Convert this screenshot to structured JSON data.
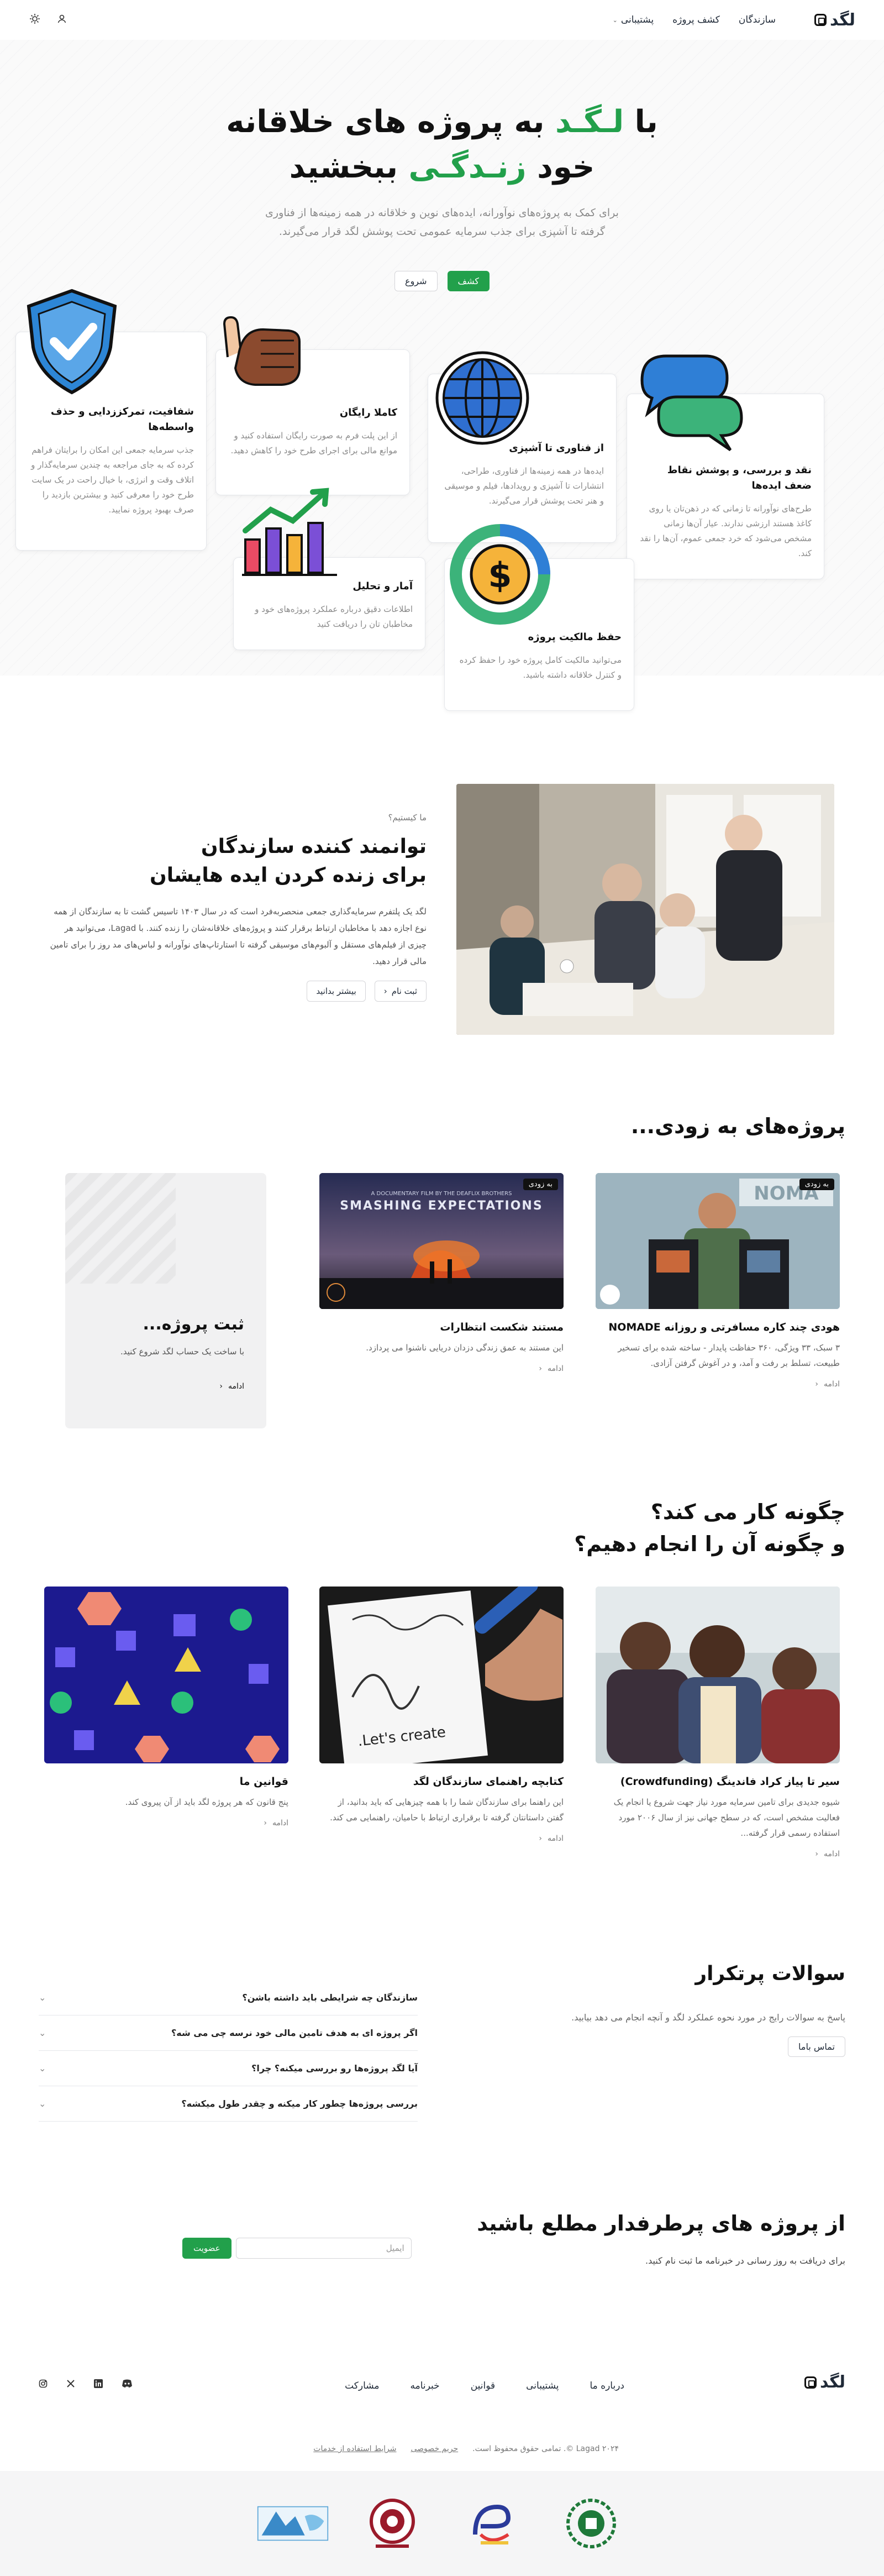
{
  "header": {
    "logo": "لگد",
    "nav": [
      "سازندگان",
      "کشف پروژه",
      "پشتیبانی"
    ],
    "nav_dropdown_icon": "chevron-down-icon"
  },
  "hero": {
    "title_line1_pre": "با",
    "title_line1_green": "لـگـد",
    "title_line1_post": "به پروژه های خلاقانه",
    "title_line2_pre": "خود",
    "title_line2_green": "زنـدگـی",
    "title_line2_post": "ببخشید",
    "subtitle": "برای کمک به پروژه‌های نوآورانه، ایده‌های نوین و خلاقانه در همه زمینه‌ها از فناوری گرفته تا آشپزی برای جذب سرمایه عمومی تحت پوشش لگد قرار می‌گیرند.",
    "btn_discover": "کشف",
    "btn_start": "شروع"
  },
  "features": [
    {
      "title": "شفافیت، تمرکززدایی و حذف واسطه‌ها",
      "desc": "جذب سرمایه جمعی این امکان را برایتان فراهم کرده که به جای مراجعه به چندین سرمایه‌گذار و اتلاف وقت و انرژی، با خیال راحت در یک سایت طرح خود را معرفی کنید و بیشترین بازدید را صرف بهبود پروژه نمایید."
    },
    {
      "title": "کاملا رایگان",
      "desc": "از این پلت فرم به صورت رایگان استفاده کنید و موانع مالی برای اجرای طرح خود را کاهش دهید."
    },
    {
      "title": "از فناوری تا آشپزی",
      "desc": "ایده‌ها در همه زمینه‌ها از فناوری، طراحی، انتشارات تا آشپزی و رویدادها، فیلم و موسیقی و هنر تحت پوشش قرار می‌گیرند."
    },
    {
      "title": "نقد و بررسی، و پوشش نقاط ضعف ایده‌ها",
      "desc": "طرح‌های نوآورانه تا زمانی که در ذهن‌تان یا روی کاغذ هستند ارزشی ندارند. عیار آن‌ها زمانی مشخص می‌شود که خرد جمعی عموم، آن‌ها را نقد کند."
    },
    {
      "title": "آمار و تحلیل",
      "desc": "اطلاعات دقیق درباره عملکرد پروژه‌های خود و مخاطبان تان را دریافت کنید"
    },
    {
      "title": "حفظ مالکیت پروژه",
      "desc": "می‌توانید مالکیت کامل پروژه خود را حفظ کرده و کنترل خلاقانه داشته باشید."
    }
  ],
  "about": {
    "eyebrow": "ما کیستیم؟",
    "title_l1": "توانمند کننده سازندگان",
    "title_l2": "برای زنده کردن ایده هایشان",
    "body": "لگد یک پلتفرم سرمایه‌گذاری جمعی منحصربه‌فرد است که در سال ۱۴۰۳ تاسیس گشت تا به سازندگان از همه نوع اجازه دهد با مخاطبان ارتباط برقرار کنند و پروژه‌های خلاقانه‌شان را زنده کنند. با Lagad، می‌توانید هر چیزی از فیلم‌های مستقل و آلبوم‌های موسیقی گرفته تا استارتاپ‌های نوآورانه و لباس‌های مد روز را برای تامین مالی قرار دهید.",
    "btn_learn": "بیشتر بدانید",
    "btn_register": "ثبت نام"
  },
  "projects": {
    "section_title": "پروژه‌های به زودی...",
    "badge": "به زودی",
    "items": [
      {
        "title": "هودی چند کاره مسافرتی و روزانه NOMADE",
        "desc": "۳ سبک، ۳۳ ویژگی، ۳۶۰ حفاظت پایدار - ساخته شده برای تسخیر طبیعت، تسلط بر رفت و آمد، و در آغوش گرفتن آزادی.",
        "more": "ادامه"
      },
      {
        "title": "مستند شکست انتظارات",
        "desc": "این مستند به عمق زندگی دزدان دریایی ناشنوا می پردازد.",
        "more": "ادامه",
        "poster_small": "A DOCUMENTARY FILM BY THE DEAFLIX BROTHERS",
        "poster_title": "SMASHING EXPECTATIONS"
      },
      {
        "title": "ثبت پروژه...",
        "desc": "با ساخت یک حساب لگد شروع کنید.",
        "more": "ادامه"
      }
    ]
  },
  "how": {
    "title_l1": "چگونه کار می کند؟",
    "title_l2": "و چگونه آن را انجام دهیم؟",
    "items": [
      {
        "title": "سیر تا پیاز کراد فاندینگ (Crowdfunding)",
        "desc": "شیوه جدیدی برای تامین سرمایه مورد نیاز جهت شروع یا انجام یک فعالیت مشخص است، که در سطح جهانی نیز از سال ۲۰۰۶ مورد استفاده رسمی قرار گرفته...",
        "more": "ادامه"
      },
      {
        "title": "کتابچه راهنمای سازندگان لگد",
        "desc": "این راهنما برای سازندگان شما را با همه چیزهایی که باید بدانید، از گفتن داستانتان گرفته تا برقراری ارتباط با حامیان، راهنمایی می کند.",
        "more": "ادامه",
        "notebook_text": "Let's create."
      },
      {
        "title": "قوانین ما",
        "desc": "پنج قانون که هر پروژه لگد باید از آن پیروی کند.",
        "more": "ادامه"
      }
    ]
  },
  "faq": {
    "title": "سوالات پرتکرار",
    "subtitle": "پاسخ به سوالات رایج در مورد نحوه عملکرد لگد و آنچه انجام می دهد بیابید.",
    "contact": "تماس باما",
    "items": [
      "سازندگان چه شرایطی باید داشته باشن؟",
      "اگر پروژه ای به هدف تامین مالی خود نرسه چی می شه؟",
      "آیا لگد پروژه‌ها رو بررسی میکنه؟ چرا؟",
      "بررسی پروژه‌ها چطور کار میکنه و چقدر طول میکشه؟"
    ]
  },
  "newsletter": {
    "title": "از پروژه های پرطرفدار مطلع باشید",
    "subtitle": "برای دریافت به روز رسانی در خبرنامه ما ثبت نام کنید.",
    "placeholder": "ایمیل",
    "button": "عضویت"
  },
  "footer": {
    "logo": "لگد",
    "links": [
      "درباره ما",
      "پشتیبانی",
      "قوانین",
      "خبرنامه",
      "مشارکت"
    ],
    "copyright": "Lagad ۲۰۲۴ ©. تمامی حقوق محفوظ است.",
    "privacy": "حریم خصوصی",
    "terms": "شرایط استفاده از خدمات"
  },
  "colors": {
    "accent": "#22a04b",
    "text": "#111111",
    "muted": "#8a8a8a"
  }
}
